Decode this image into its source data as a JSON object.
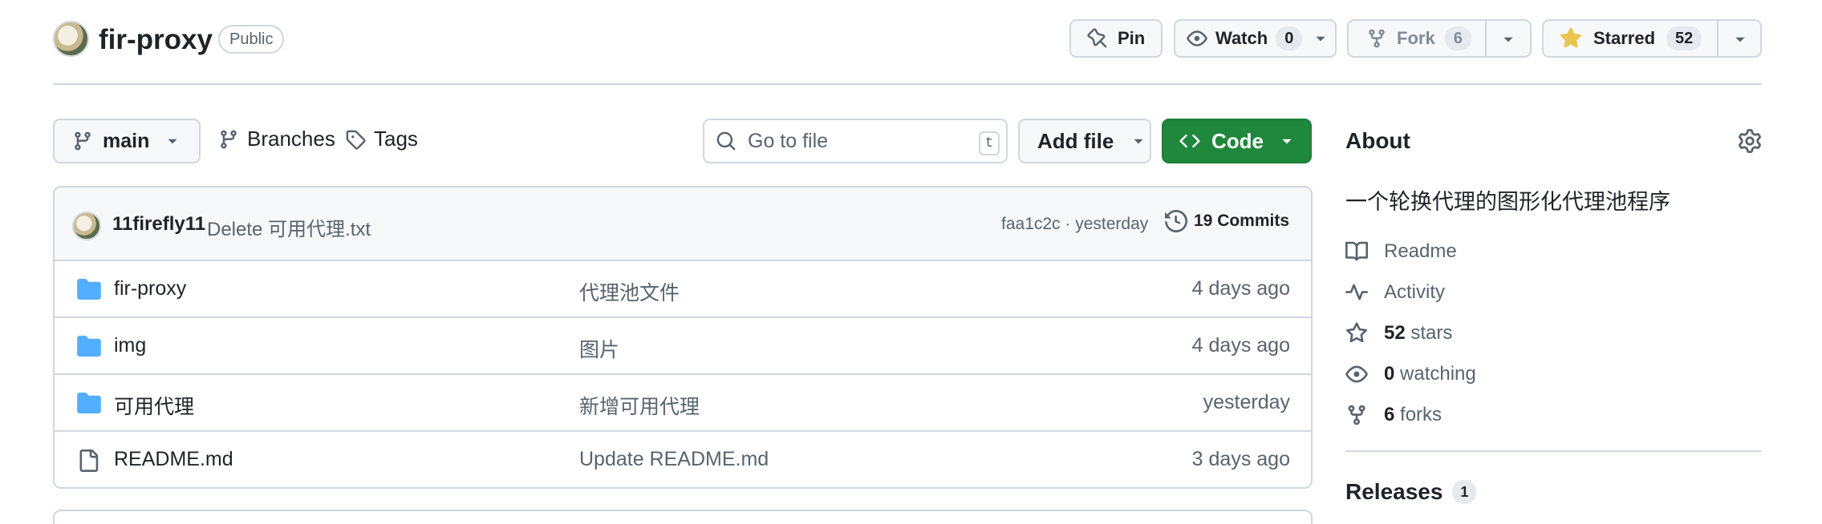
{
  "repo": {
    "name": "fir-proxy",
    "visibility": "Public"
  },
  "actions": {
    "pin_label": "Pin",
    "watch_label": "Watch",
    "watch_count": "0",
    "fork_label": "Fork",
    "fork_count": "6",
    "star_label": "Starred",
    "star_count": "52"
  },
  "toolbar": {
    "branch": "main",
    "branches_label": "Branches",
    "tags_label": "Tags",
    "goto_placeholder": "Go to file",
    "goto_shortcut": "t",
    "add_file_label": "Add file",
    "code_label": "Code"
  },
  "latest_commit": {
    "author": "11firefly11",
    "message": "Delete 可用代理.txt",
    "meta": "faa1c2c · yesterday",
    "commits_label": "19 Commits"
  },
  "files": [
    {
      "name": "fir-proxy",
      "type": "folder",
      "message": "代理池文件",
      "age": "4 days ago"
    },
    {
      "name": "img",
      "type": "folder",
      "message": "图片",
      "age": "4 days ago"
    },
    {
      "name": "可用代理",
      "type": "folder",
      "message": "新增可用代理",
      "age": "yesterday"
    },
    {
      "name": "README.md",
      "type": "file",
      "message": "Update README.md",
      "age": "3 days ago"
    }
  ],
  "about": {
    "title": "About",
    "description": "一个轮换代理的图形化代理池程序",
    "items": [
      {
        "icon": "book-icon",
        "count": "",
        "label": "Readme"
      },
      {
        "icon": "pulse-icon",
        "count": "",
        "label": "Activity"
      },
      {
        "icon": "star-icon",
        "count": "52",
        "label": "stars"
      },
      {
        "icon": "eye-icon",
        "count": "0",
        "label": "watching"
      },
      {
        "icon": "fork-icon",
        "count": "6",
        "label": "forks"
      }
    ]
  },
  "releases": {
    "title": "Releases",
    "count": "1"
  },
  "colors": {
    "accent_green": "#1f883d",
    "folder_blue": "#54aeff",
    "star_yellow": "#eac54f",
    "border": "#d0d7de",
    "muted_text": "#59636e"
  }
}
